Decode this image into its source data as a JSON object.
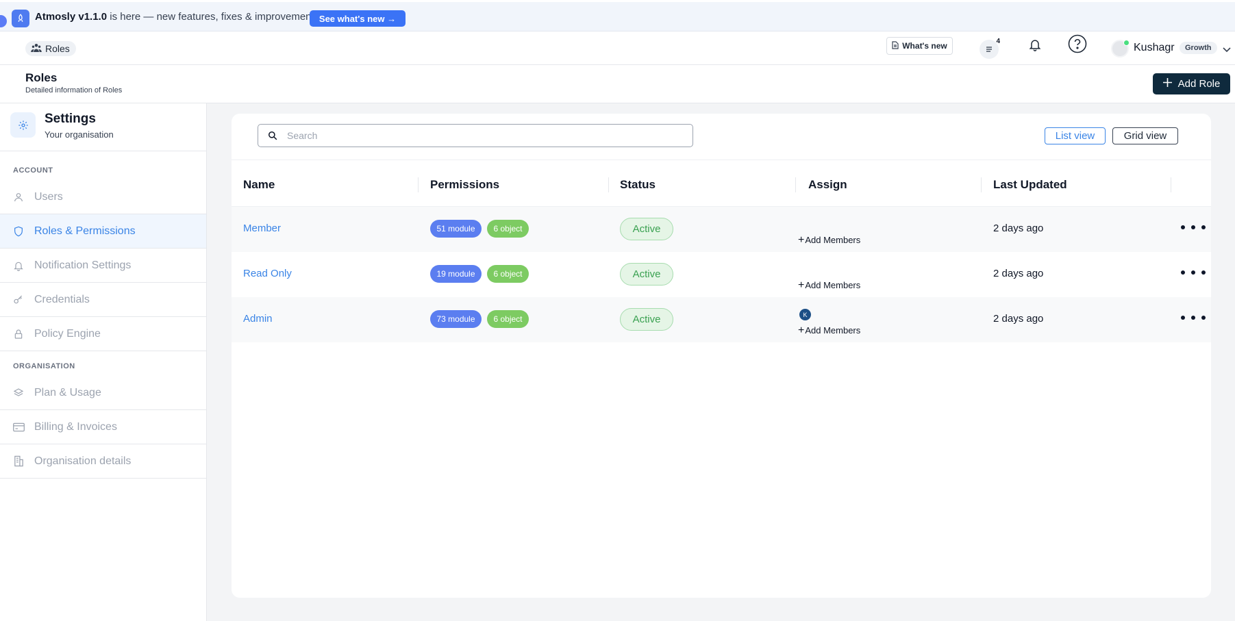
{
  "announcement": {
    "version": "Atmosly v1.1.0",
    "text": " is here — new features, fixes & improvements.",
    "cta": "See what's new →"
  },
  "topbar": {
    "breadcrumb": "Roles",
    "whats_new": "What's new",
    "notification_count": "4",
    "user_name": "Kushagr",
    "plan": "Growth"
  },
  "page": {
    "title": "Roles",
    "subtitle": "Detailed information of Roles",
    "add_button": "Add Role"
  },
  "sidebar": {
    "title": "Settings",
    "subtitle": "Your organisation",
    "sections": [
      {
        "label": "ACCOUNT",
        "items": [
          {
            "label": "Users",
            "icon": "user-icon",
            "active": false
          },
          {
            "label": "Roles & Permissions",
            "icon": "shield-icon",
            "active": true
          },
          {
            "label": "Notification Settings",
            "icon": "bell-icon",
            "active": false
          },
          {
            "label": "Credentials",
            "icon": "key-icon",
            "active": false
          },
          {
            "label": "Policy Engine",
            "icon": "lock-icon",
            "active": false
          }
        ]
      },
      {
        "label": "ORGANISATION",
        "items": [
          {
            "label": "Plan & Usage",
            "icon": "layers-icon",
            "active": false
          },
          {
            "label": "Billing & Invoices",
            "icon": "credit-card-icon",
            "active": false
          },
          {
            "label": "Organisation details",
            "icon": "building-icon",
            "active": false
          }
        ]
      }
    ]
  },
  "toolbar": {
    "search_placeholder": "Search",
    "list_view": "List view",
    "grid_view": "Grid view"
  },
  "table": {
    "columns": [
      "Name",
      "Permissions",
      "Status",
      "Assign",
      "Last Updated"
    ],
    "add_members_label": "Add Members",
    "rows": [
      {
        "name": "Member",
        "modules": "51 module",
        "objects": "6 object",
        "status": "Active",
        "members": [],
        "updated": "2 days ago"
      },
      {
        "name": "Read Only",
        "modules": "19 module",
        "objects": "6 object",
        "status": "Active",
        "members": [],
        "updated": "2 days ago"
      },
      {
        "name": "Admin",
        "modules": "73 module",
        "objects": "6 object",
        "status": "Active",
        "members": [
          "K"
        ],
        "updated": "2 days ago"
      }
    ]
  },
  "colors": {
    "accent": "#3a84e6",
    "primary_dark": "#0f2a3d",
    "module_pill": "#5b7ef0",
    "object_pill": "#7dcb62",
    "status_active": "#3aa151"
  }
}
